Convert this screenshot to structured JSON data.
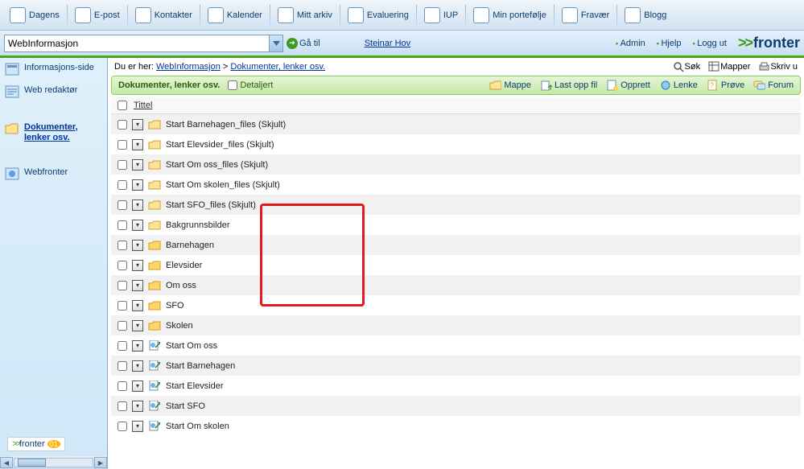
{
  "topnav": [
    {
      "label": "Dagens"
    },
    {
      "label": "E-post"
    },
    {
      "label": "Kontakter"
    },
    {
      "label": "Kalender"
    },
    {
      "label": "Mitt arkiv"
    },
    {
      "label": "Evaluering"
    },
    {
      "label": "IUP"
    },
    {
      "label": "Min portefølje"
    },
    {
      "label": "Fravær"
    },
    {
      "label": "Blogg"
    }
  ],
  "combo_value": "WebInformasjon",
  "go_label": "Gå til",
  "user": "Steinar Hov",
  "rightlinks": {
    "admin": "Admin",
    "help": "Hjelp",
    "logout": "Logg ut"
  },
  "brand": "fronter",
  "sidebar": [
    {
      "label": "Informasjons-side",
      "active": false
    },
    {
      "label": "Web redaktør",
      "active": false
    },
    {
      "label": "Dokumenter, lenker osv.",
      "active": true
    },
    {
      "label": "Webfronter",
      "active": false
    }
  ],
  "sidebar_logo": "fronter",
  "breadcrumb": {
    "prefix": "Du er her: ",
    "p1": "WebInformasjon",
    "sep": " > ",
    "p2": "Dokumenter, lenker osv."
  },
  "top_actions": {
    "search": "Søk",
    "folders": "Mapper",
    "print": "Skriv u"
  },
  "green": {
    "title": "Dokumenter, lenker osv.",
    "detail": "Detaljert",
    "buttons": {
      "mappe": "Mappe",
      "upload": "Last opp fil",
      "create": "Opprett",
      "link": "Lenke",
      "test": "Prøve",
      "forum": "Forum"
    }
  },
  "list_header": "Tittel",
  "rows": [
    {
      "label": "Start Barnehagen_files (Skjult)",
      "type": "folder-y"
    },
    {
      "label": "Start Elevsider_files (Skjult)",
      "type": "folder-y"
    },
    {
      "label": "Start Om oss_files (Skjult)",
      "type": "folder-y"
    },
    {
      "label": "Start Om skolen_files (Skjult)",
      "type": "folder-y"
    },
    {
      "label": "Start SFO_files (Skjult)",
      "type": "folder-y"
    },
    {
      "label": "Bakgrunnsbilder",
      "type": "folder-y"
    },
    {
      "label": "Barnehagen",
      "type": "folder-o"
    },
    {
      "label": "Elevsider",
      "type": "folder-o"
    },
    {
      "label": "Om oss",
      "type": "folder-o"
    },
    {
      "label": "SFO",
      "type": "folder-o"
    },
    {
      "label": "Skolen",
      "type": "folder-o"
    },
    {
      "label": "Start Om oss",
      "type": "page"
    },
    {
      "label": "Start Barnehagen",
      "type": "page"
    },
    {
      "label": "Start Elevsider",
      "type": "page"
    },
    {
      "label": "Start SFO",
      "type": "page"
    },
    {
      "label": "Start Om skolen",
      "type": "page"
    }
  ]
}
